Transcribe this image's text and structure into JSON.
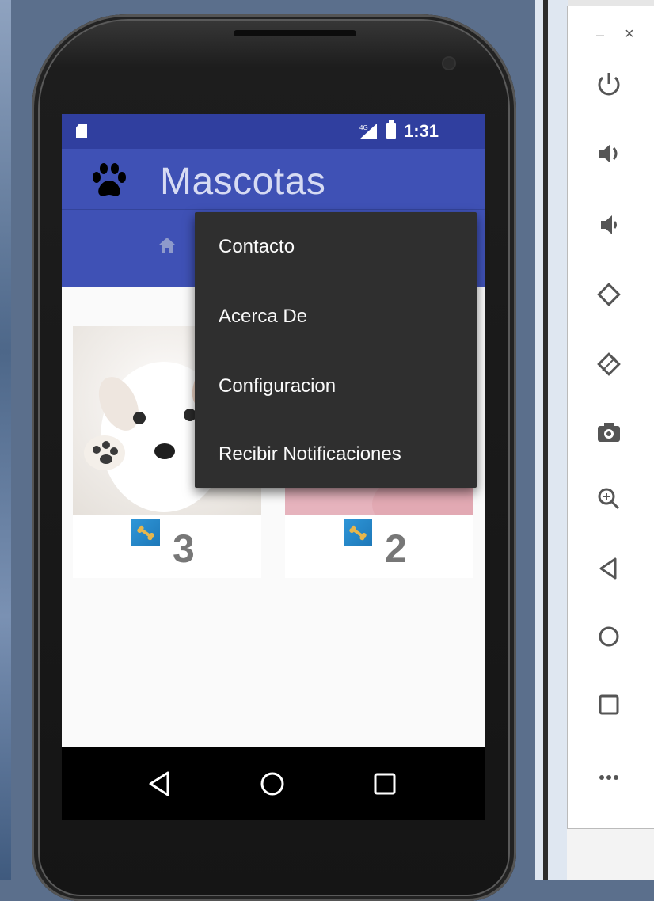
{
  "status_bar": {
    "network": "4G",
    "time": "1:31"
  },
  "toolbar": {
    "title": "Mascotas"
  },
  "overflow_menu": {
    "items": [
      "Contacto",
      "Acerca De",
      "Configuracion",
      "Recibir Notificaciones"
    ]
  },
  "pets": [
    {
      "likes": "3"
    },
    {
      "likes": "2"
    }
  ],
  "emulator_window": {
    "minimize": "–",
    "close": "×"
  },
  "colors": {
    "status_bar": "#303f9f",
    "toolbar": "#3f51b5",
    "menu_bg": "#2f2f2f",
    "bone_badge": "#2e96d8"
  },
  "icons": {
    "app": "paw-icon",
    "tab": "home-icon",
    "emulator_controls": [
      "power-icon",
      "volume-up-icon",
      "volume-down-icon",
      "rotate-left-icon",
      "rotate-right-icon",
      "camera-icon",
      "zoom-icon",
      "back-icon",
      "home-icon",
      "overview-icon",
      "more-icon"
    ]
  }
}
